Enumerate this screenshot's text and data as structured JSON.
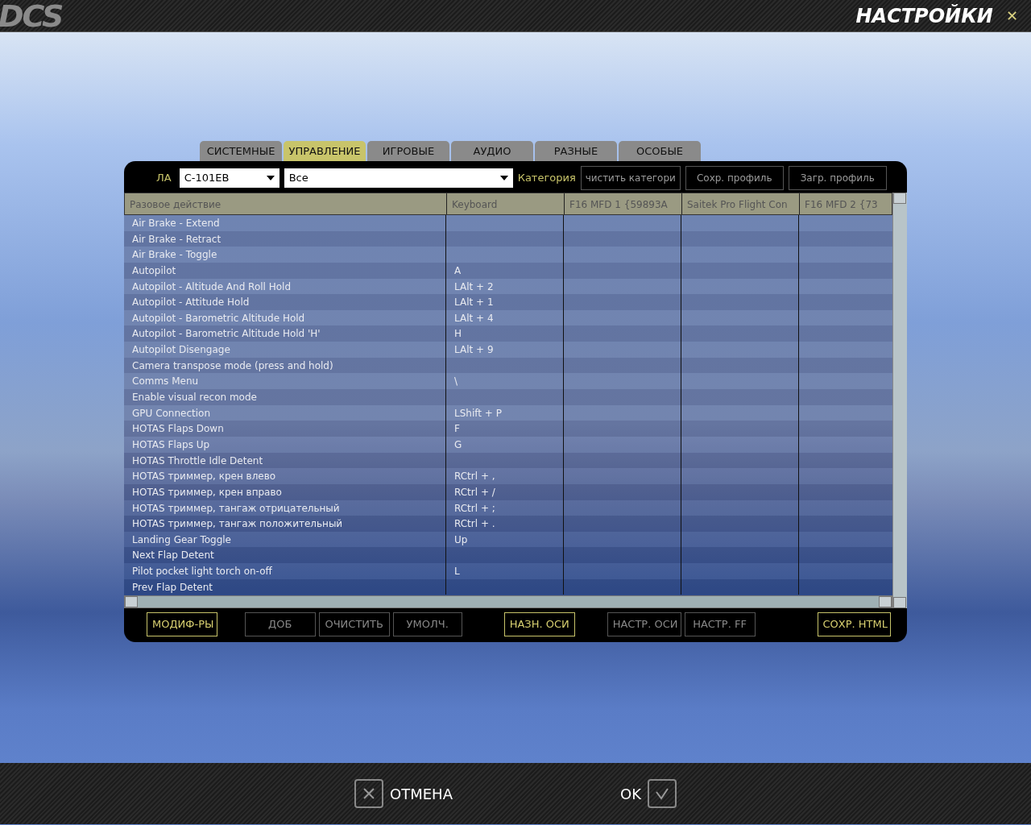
{
  "header": {
    "logo": "DCS",
    "title": "НАСТРОЙКИ",
    "close": "✕"
  },
  "tabs": [
    {
      "label": "СИСТЕМНЫЕ",
      "selected": false
    },
    {
      "label": "УПРАВЛЕНИЕ",
      "selected": true
    },
    {
      "label": "ИГРОВЫЕ",
      "selected": false
    },
    {
      "label": "АУДИО",
      "selected": false
    },
    {
      "label": "РАЗНЫЕ",
      "selected": false
    },
    {
      "label": "ОСОБЫЕ",
      "selected": false
    }
  ],
  "toolbar": {
    "aircraft_label": "ЛА",
    "aircraft": "С-101ЕВ",
    "filter": "Все",
    "category_label": "Категория",
    "buttons": [
      "чистить категори",
      "Сохр. профиль",
      "Загр. профиль"
    ]
  },
  "table": {
    "columns": [
      "Разовое действие",
      "Keyboard",
      "F16 MFD 1 {59893A",
      "Saitek Pro Flight Con",
      "F16 MFD 2 {73"
    ],
    "rows": [
      {
        "action": "Air Brake - Extend",
        "key": ""
      },
      {
        "action": "Air Brake - Retract",
        "key": ""
      },
      {
        "action": "Air Brake - Toggle",
        "key": ""
      },
      {
        "action": "Autopilot",
        "key": "A"
      },
      {
        "action": "Autopilot - Altitude And Roll Hold",
        "key": "LAlt + 2"
      },
      {
        "action": "Autopilot - Attitude Hold",
        "key": "LAlt + 1"
      },
      {
        "action": "Autopilot - Barometric Altitude Hold",
        "key": "LAlt + 4"
      },
      {
        "action": "Autopilot - Barometric Altitude Hold 'H'",
        "key": "H"
      },
      {
        "action": "Autopilot Disengage",
        "key": "LAlt + 9"
      },
      {
        "action": "Camera transpose mode (press and hold)",
        "key": ""
      },
      {
        "action": "Comms Menu",
        "key": "\\"
      },
      {
        "action": "Enable visual recon mode",
        "key": ""
      },
      {
        "action": "GPU Connection",
        "key": "LShift + P"
      },
      {
        "action": "HOTAS Flaps Down",
        "key": "F"
      },
      {
        "action": "HOTAS Flaps Up",
        "key": "G"
      },
      {
        "action": "HOTAS Throttle Idle Detent",
        "key": ""
      },
      {
        "action": "HOTAS триммер, крен влево",
        "key": "RCtrl + ,"
      },
      {
        "action": "HOTAS триммер, крен вправо",
        "key": "RCtrl + /"
      },
      {
        "action": "HOTAS триммер, тангаж отрицательный",
        "key": "RCtrl + ;"
      },
      {
        "action": "HOTAS триммер, тангаж положительный",
        "key": "RCtrl + ."
      },
      {
        "action": "Landing Gear Toggle",
        "key": "Up"
      },
      {
        "action": "Next Flap Detent",
        "key": ""
      },
      {
        "action": "Pilot pocket light torch on-off",
        "key": "L"
      },
      {
        "action": "Prev Flap Detent",
        "key": ""
      }
    ]
  },
  "actions": [
    {
      "label": "МОДИФ-РЫ",
      "disabled": false
    },
    {
      "label": "ДОБ",
      "disabled": true
    },
    {
      "label": "ОЧИСТИТЬ",
      "disabled": true
    },
    {
      "label": "УМОЛЧ.",
      "disabled": true
    },
    {
      "label": "НАЗН. ОСИ",
      "disabled": false
    },
    {
      "label": "НАСТР. ОСИ",
      "disabled": true
    },
    {
      "label": "НАСТР. FF",
      "disabled": true
    },
    {
      "label": "СОХР. HTML",
      "disabled": false
    }
  ],
  "footer": {
    "cancel": "ОТМЕНА",
    "ok": "OK"
  }
}
